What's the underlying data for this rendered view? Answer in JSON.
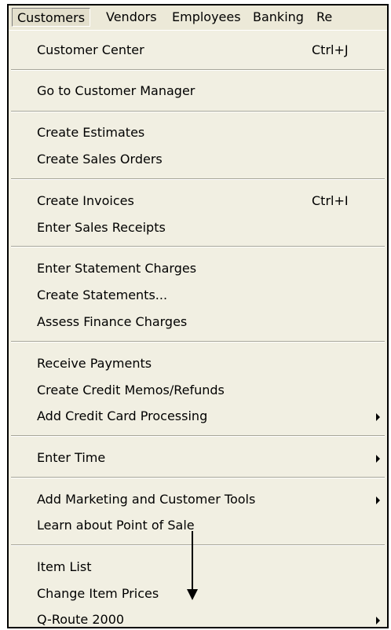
{
  "menubar": {
    "items": [
      {
        "label": "Customers",
        "active": true
      },
      {
        "label": "Vendors",
        "active": false
      },
      {
        "label": "Employees",
        "active": false
      },
      {
        "label": "Banking",
        "active": false
      },
      {
        "label": "Re",
        "active": false
      }
    ]
  },
  "menu": {
    "groups": [
      [
        {
          "label": "Customer Center",
          "shortcut": "Ctrl+J"
        }
      ],
      [
        {
          "label": "Go to Customer Manager"
        }
      ],
      [
        {
          "label": "Create Estimates"
        },
        {
          "label": "Create Sales Orders"
        }
      ],
      [
        {
          "label": "Create Invoices",
          "shortcut": "Ctrl+I"
        },
        {
          "label": "Enter Sales Receipts"
        }
      ],
      [
        {
          "label": "Enter Statement Charges"
        },
        {
          "label": "Create Statements..."
        },
        {
          "label": "Assess Finance Charges"
        }
      ],
      [
        {
          "label": "Receive Payments"
        },
        {
          "label": "Create Credit Memos/Refunds"
        },
        {
          "label": "Add Credit Card Processing",
          "submenu": true
        }
      ],
      [
        {
          "label": "Enter Time",
          "submenu": true
        }
      ],
      [
        {
          "label": "Add Marketing and Customer Tools",
          "submenu": true
        },
        {
          "label": "Learn about Point of Sale"
        }
      ],
      [
        {
          "label": "Item List"
        },
        {
          "label": "Change Item Prices"
        },
        {
          "label": "Q-Route 2000",
          "submenu": true
        }
      ]
    ]
  },
  "colors": {
    "menubar_bg": "#ece9d8",
    "menu_bg": "#f1efe2",
    "separator": "#a7a699",
    "frame_border": "#000000",
    "annotation_arrow": "#000000"
  },
  "icons": {
    "submenu": "triangle-right-icon",
    "annotation": "down-arrow-icon"
  }
}
